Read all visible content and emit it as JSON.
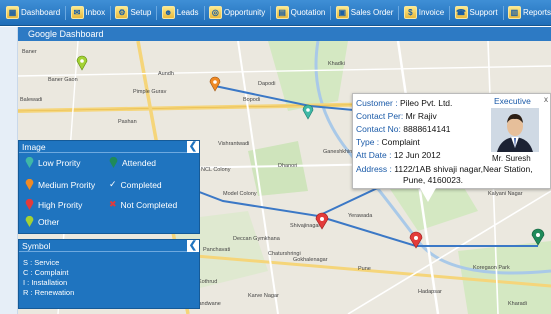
{
  "toolbar": {
    "items": [
      {
        "label": "Dashboard",
        "icon": "dashboard-icon"
      },
      {
        "label": "Inbox",
        "icon": "inbox-icon"
      },
      {
        "label": "Setup",
        "icon": "setup-icon"
      },
      {
        "label": "Leads",
        "icon": "leads-icon"
      },
      {
        "label": "Opportunity",
        "icon": "opportunity-icon"
      },
      {
        "label": "Quotation",
        "icon": "quotation-icon"
      },
      {
        "label": "Sales Order",
        "icon": "sales-order-icon"
      },
      {
        "label": "Invoice",
        "icon": "invoice-icon"
      },
      {
        "label": "Support",
        "icon": "support-icon"
      },
      {
        "label": "Reports",
        "icon": "reports-icon"
      }
    ]
  },
  "title": "Google Dashboard",
  "image_panel": {
    "title": "Image",
    "collapse": "❮",
    "left": [
      {
        "label": "Low Prority",
        "color": "#3fb8a6"
      },
      {
        "label": "Medium Prority",
        "color": "#f08a24"
      },
      {
        "label": "High Prority",
        "color": "#e33b3b"
      },
      {
        "label": "Other",
        "color": "#a4d234"
      }
    ],
    "right": [
      {
        "label": "Attended",
        "color": "#1f8a5a"
      },
      {
        "label": "Completed",
        "color": "#ffffff"
      },
      {
        "label": "Not Completed",
        "color": "#e33b3b"
      }
    ]
  },
  "symbol_panel": {
    "title": "Symbol",
    "collapse": "❮",
    "lines": [
      "S : Service",
      "C : Complaint",
      "I : Installation",
      "R : Renewation"
    ]
  },
  "info": {
    "customer_label": "Customer :",
    "customer": "Pileo Pvt. Ltd.",
    "contact_per_label": "Contact Per:",
    "contact_per": "Mr Rajiv",
    "contact_no_label": "Contact No:",
    "contact_no": "8888614141",
    "type_label": "Type :",
    "type": "Complaint",
    "att_date_label": "Att Date :",
    "att_date": "12 Jun 2012",
    "address_label": "Address :",
    "address_1": "1122/1AB shivaji nagar,Near Station,",
    "address_2": "Pune, 4160023.",
    "executive_title": "Executive",
    "executive_name": "Mr. Suresh",
    "close": "x"
  },
  "map_labels": [
    "Baner",
    "Baner Gaon",
    "Balewadi",
    "Aundh",
    "Pashan",
    "Pimple Gurav",
    "Dapodi",
    "Khadki",
    "Bopodi",
    "Kalyani Nagar",
    "Yerawada",
    "Kothrud",
    "Karve Nagar",
    "Shivajinagar",
    "Deccan Gymkhana",
    "Chaturshringi",
    "Panchavati",
    "Kharadi",
    "Hadapsar",
    "Koregaon Park",
    "Pune",
    "Erandwane",
    "Dhanori",
    "Vishrantwadi",
    "Model Colony",
    "Ganeshkhind",
    "Gokhalenagar",
    "NCL Colony"
  ]
}
